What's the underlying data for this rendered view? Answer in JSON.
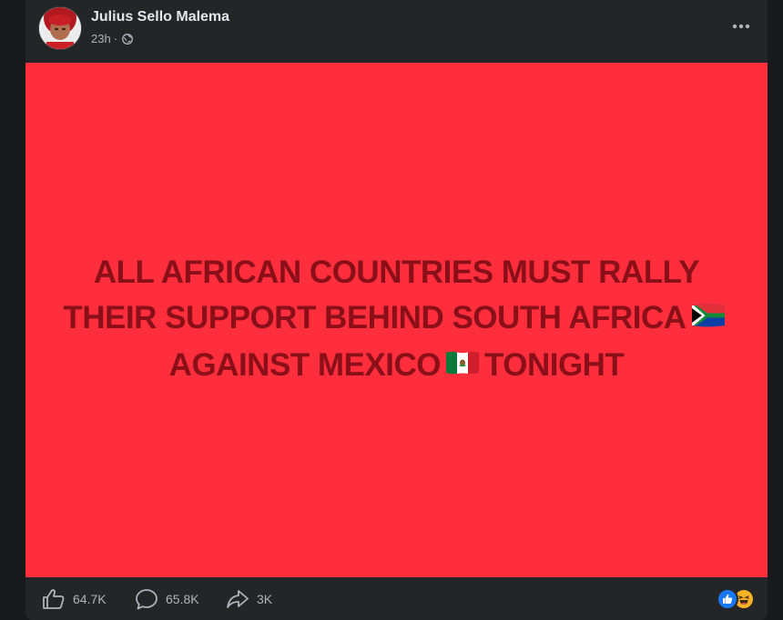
{
  "post": {
    "author": "Julius Sello Malema",
    "time": "23h",
    "separator": "·",
    "audience_icon": "globe-icon",
    "banner": {
      "line1": "ALL AFRICAN COUNTRIES MUST RALLY",
      "line2": "THEIR SUPPORT BEHIND SOUTH AFRICA",
      "line3a": "AGAINST MEXICO",
      "line3b": "TONIGHT",
      "background_color": "#fe2e3c",
      "text_color": "#8a0f18"
    }
  },
  "stats": {
    "likes": "64.7K",
    "comments": "65.8K",
    "shares": "3K"
  },
  "reactions": [
    "like-icon",
    "haha-icon"
  ]
}
